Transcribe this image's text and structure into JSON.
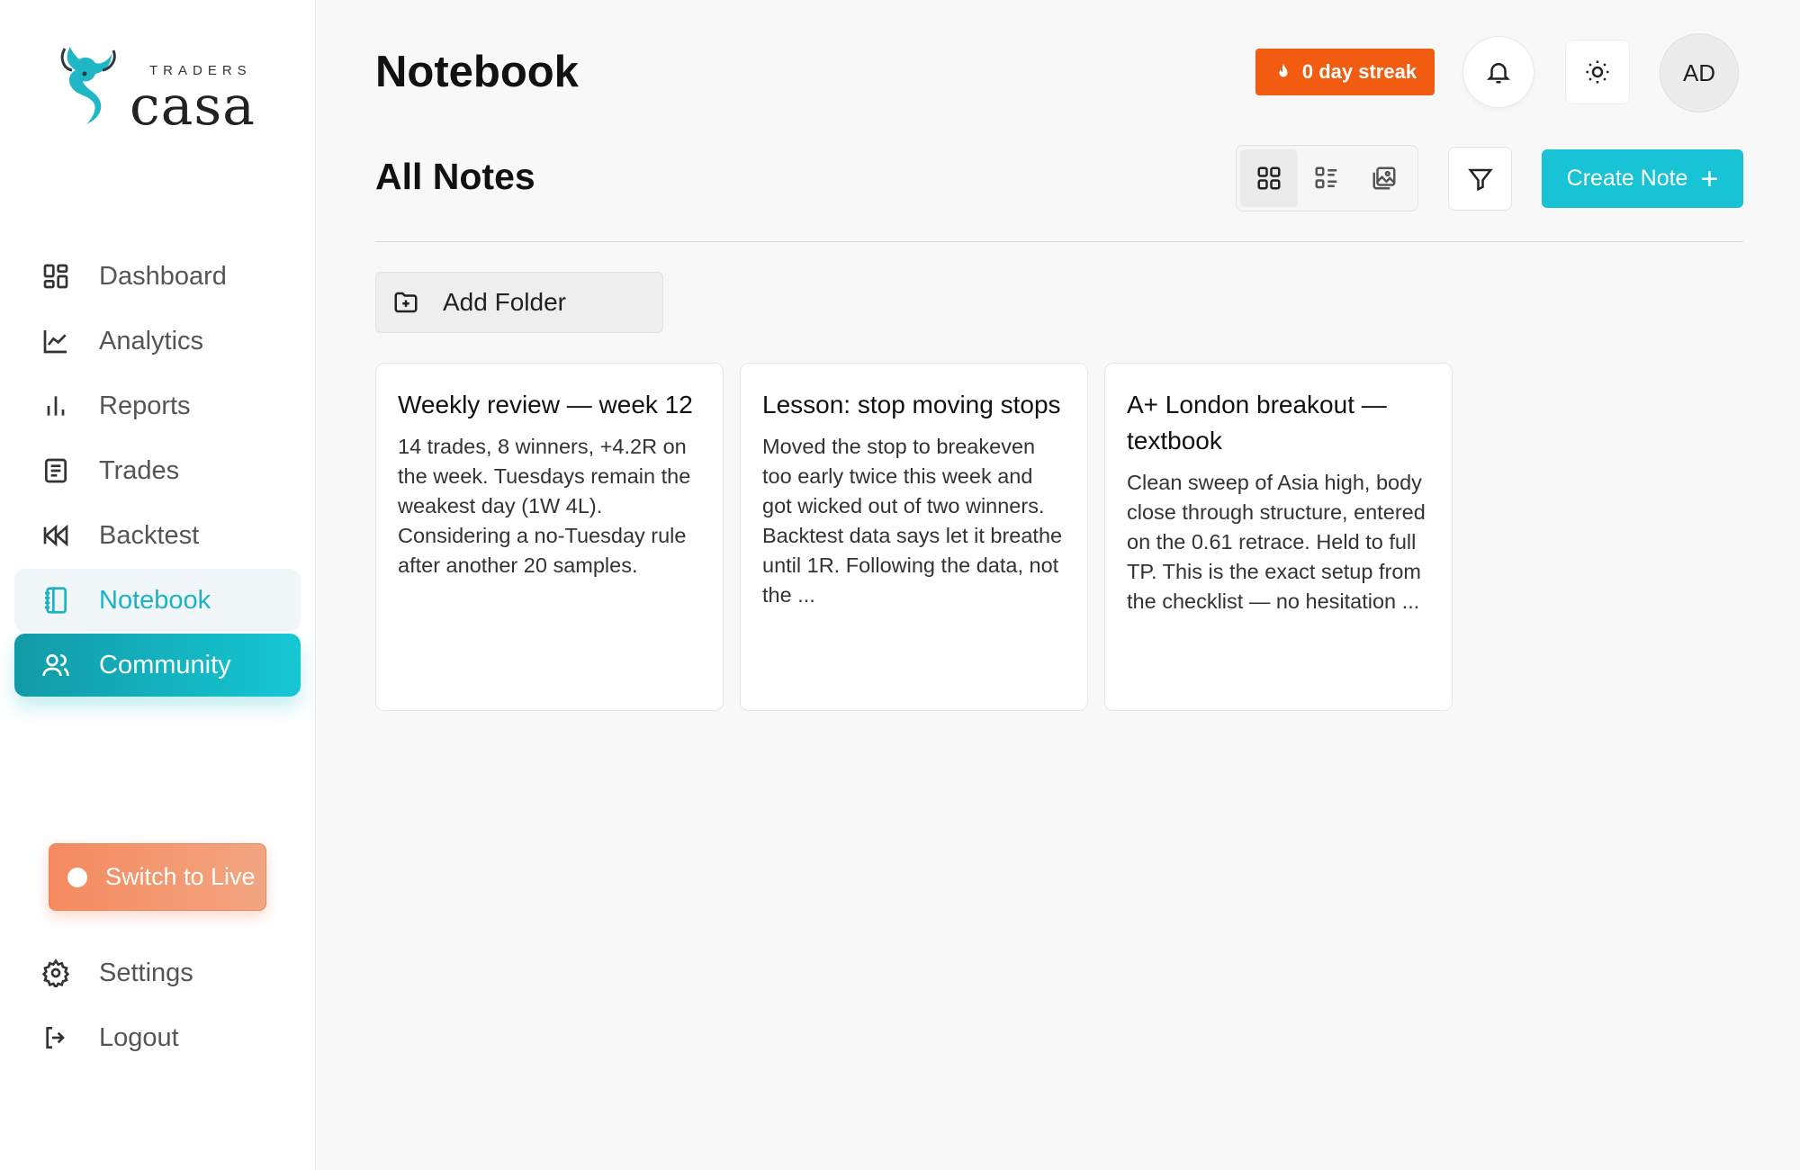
{
  "brand": {
    "small": "TRADERS",
    "big": "casa"
  },
  "sidebar": {
    "items": [
      {
        "label": "Dashboard"
      },
      {
        "label": "Analytics"
      },
      {
        "label": "Reports"
      },
      {
        "label": "Trades"
      },
      {
        "label": "Backtest"
      },
      {
        "label": "Notebook"
      },
      {
        "label": "Community"
      }
    ],
    "switch_live": "Switch to Live",
    "bottom": [
      {
        "label": "Settings"
      },
      {
        "label": "Logout"
      }
    ]
  },
  "header": {
    "title": "Notebook",
    "streak": "0 day streak",
    "avatar": "AD"
  },
  "toolbar": {
    "section_title": "All Notes",
    "create_label": "Create Note",
    "add_folder": "Add Folder"
  },
  "notes": [
    {
      "title": "Weekly review — week 12",
      "body": "14 trades, 8 winners, +4.2R on the week. Tuesdays remain the weakest day (1W 4L). Considering a no-Tuesday rule after another 20 samples."
    },
    {
      "title": "Lesson: stop moving stops",
      "body": "Moved the stop to breakeven too early twice this week and got wicked out of two winners. Backtest data says let it breathe until 1R. Following the data, not the ..."
    },
    {
      "title": "A+ London breakout — textbook",
      "body": "Clean sweep of Asia high, body close through structure, entered on the 0.61 retrace. Held to full TP. This is the exact setup from the checklist — no hesitation ..."
    }
  ],
  "colors": {
    "accent": "#18c3d6",
    "streak": "#f25c10",
    "live": "#f58a5f"
  }
}
